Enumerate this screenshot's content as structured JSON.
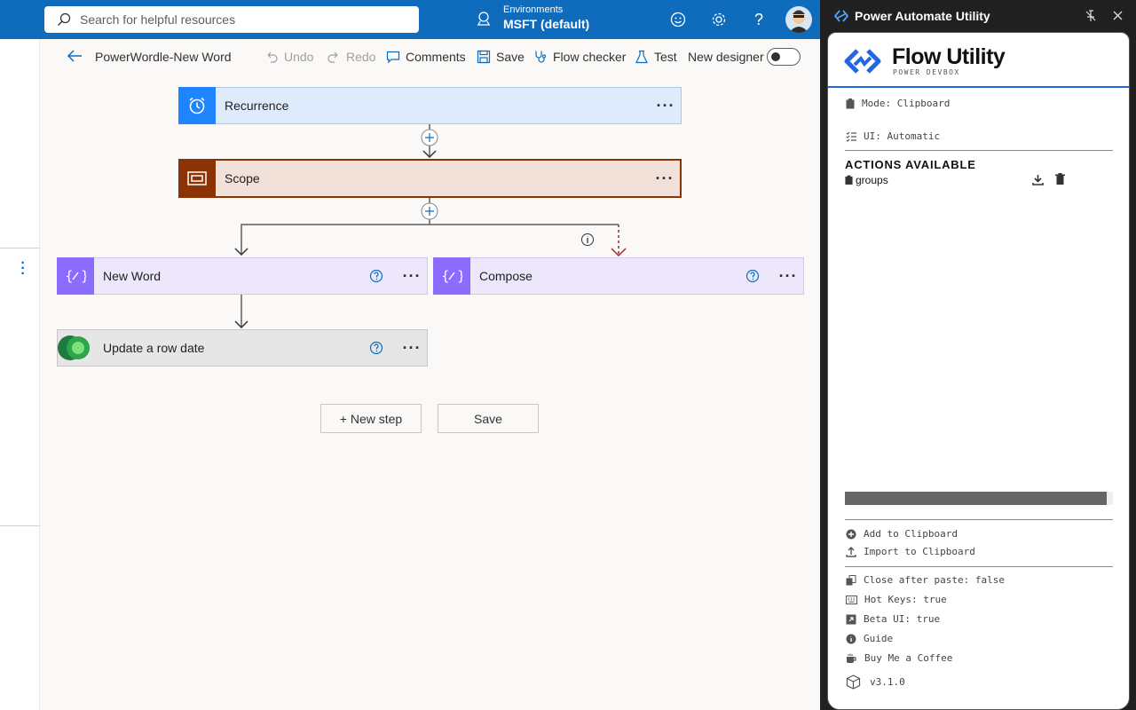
{
  "header": {
    "search_placeholder": "Search for helpful resources",
    "env_label": "Environments",
    "env_value": "MSFT (default)"
  },
  "command_bar": {
    "flow_name": "PowerWordle-New Word",
    "undo": "Undo",
    "redo": "Redo",
    "comments": "Comments",
    "save": "Save",
    "flow_checker": "Flow checker",
    "test": "Test",
    "new_designer": "New designer"
  },
  "flow": {
    "steps": [
      {
        "title": "Recurrence"
      },
      {
        "title": "Scope"
      },
      {
        "title": "New Word"
      },
      {
        "title": "Compose"
      },
      {
        "title": "Update a row date"
      }
    ],
    "new_step": "+ New step",
    "save": "Save"
  },
  "extension": {
    "window_title": "Power Automate Utility",
    "brand_name": "Flow Utility",
    "brand_sub": "POWER DEVBOX",
    "mode": "Mode: Clipboard",
    "ui": "UI: Automatic",
    "actions_heading": "ACTIONS AVAILABLE",
    "groups_label": "groups",
    "add_to_clipboard": "Add to Clipboard",
    "import_to_clipboard": "Import to Clipboard",
    "close_after_paste": "Close after paste: false",
    "hot_keys": "Hot Keys: true",
    "beta_ui": "Beta UI: true",
    "guide": "Guide",
    "coffee": "Buy Me a Coffee",
    "version": "v3.1.0"
  },
  "colors": {
    "header_blue": "#0f6cbd",
    "recurrence_blue": "#1f85ff",
    "scope_brown": "#8c3306",
    "variable_purple": "#8c6cff",
    "dataverse_green": "#1e7a3e"
  }
}
